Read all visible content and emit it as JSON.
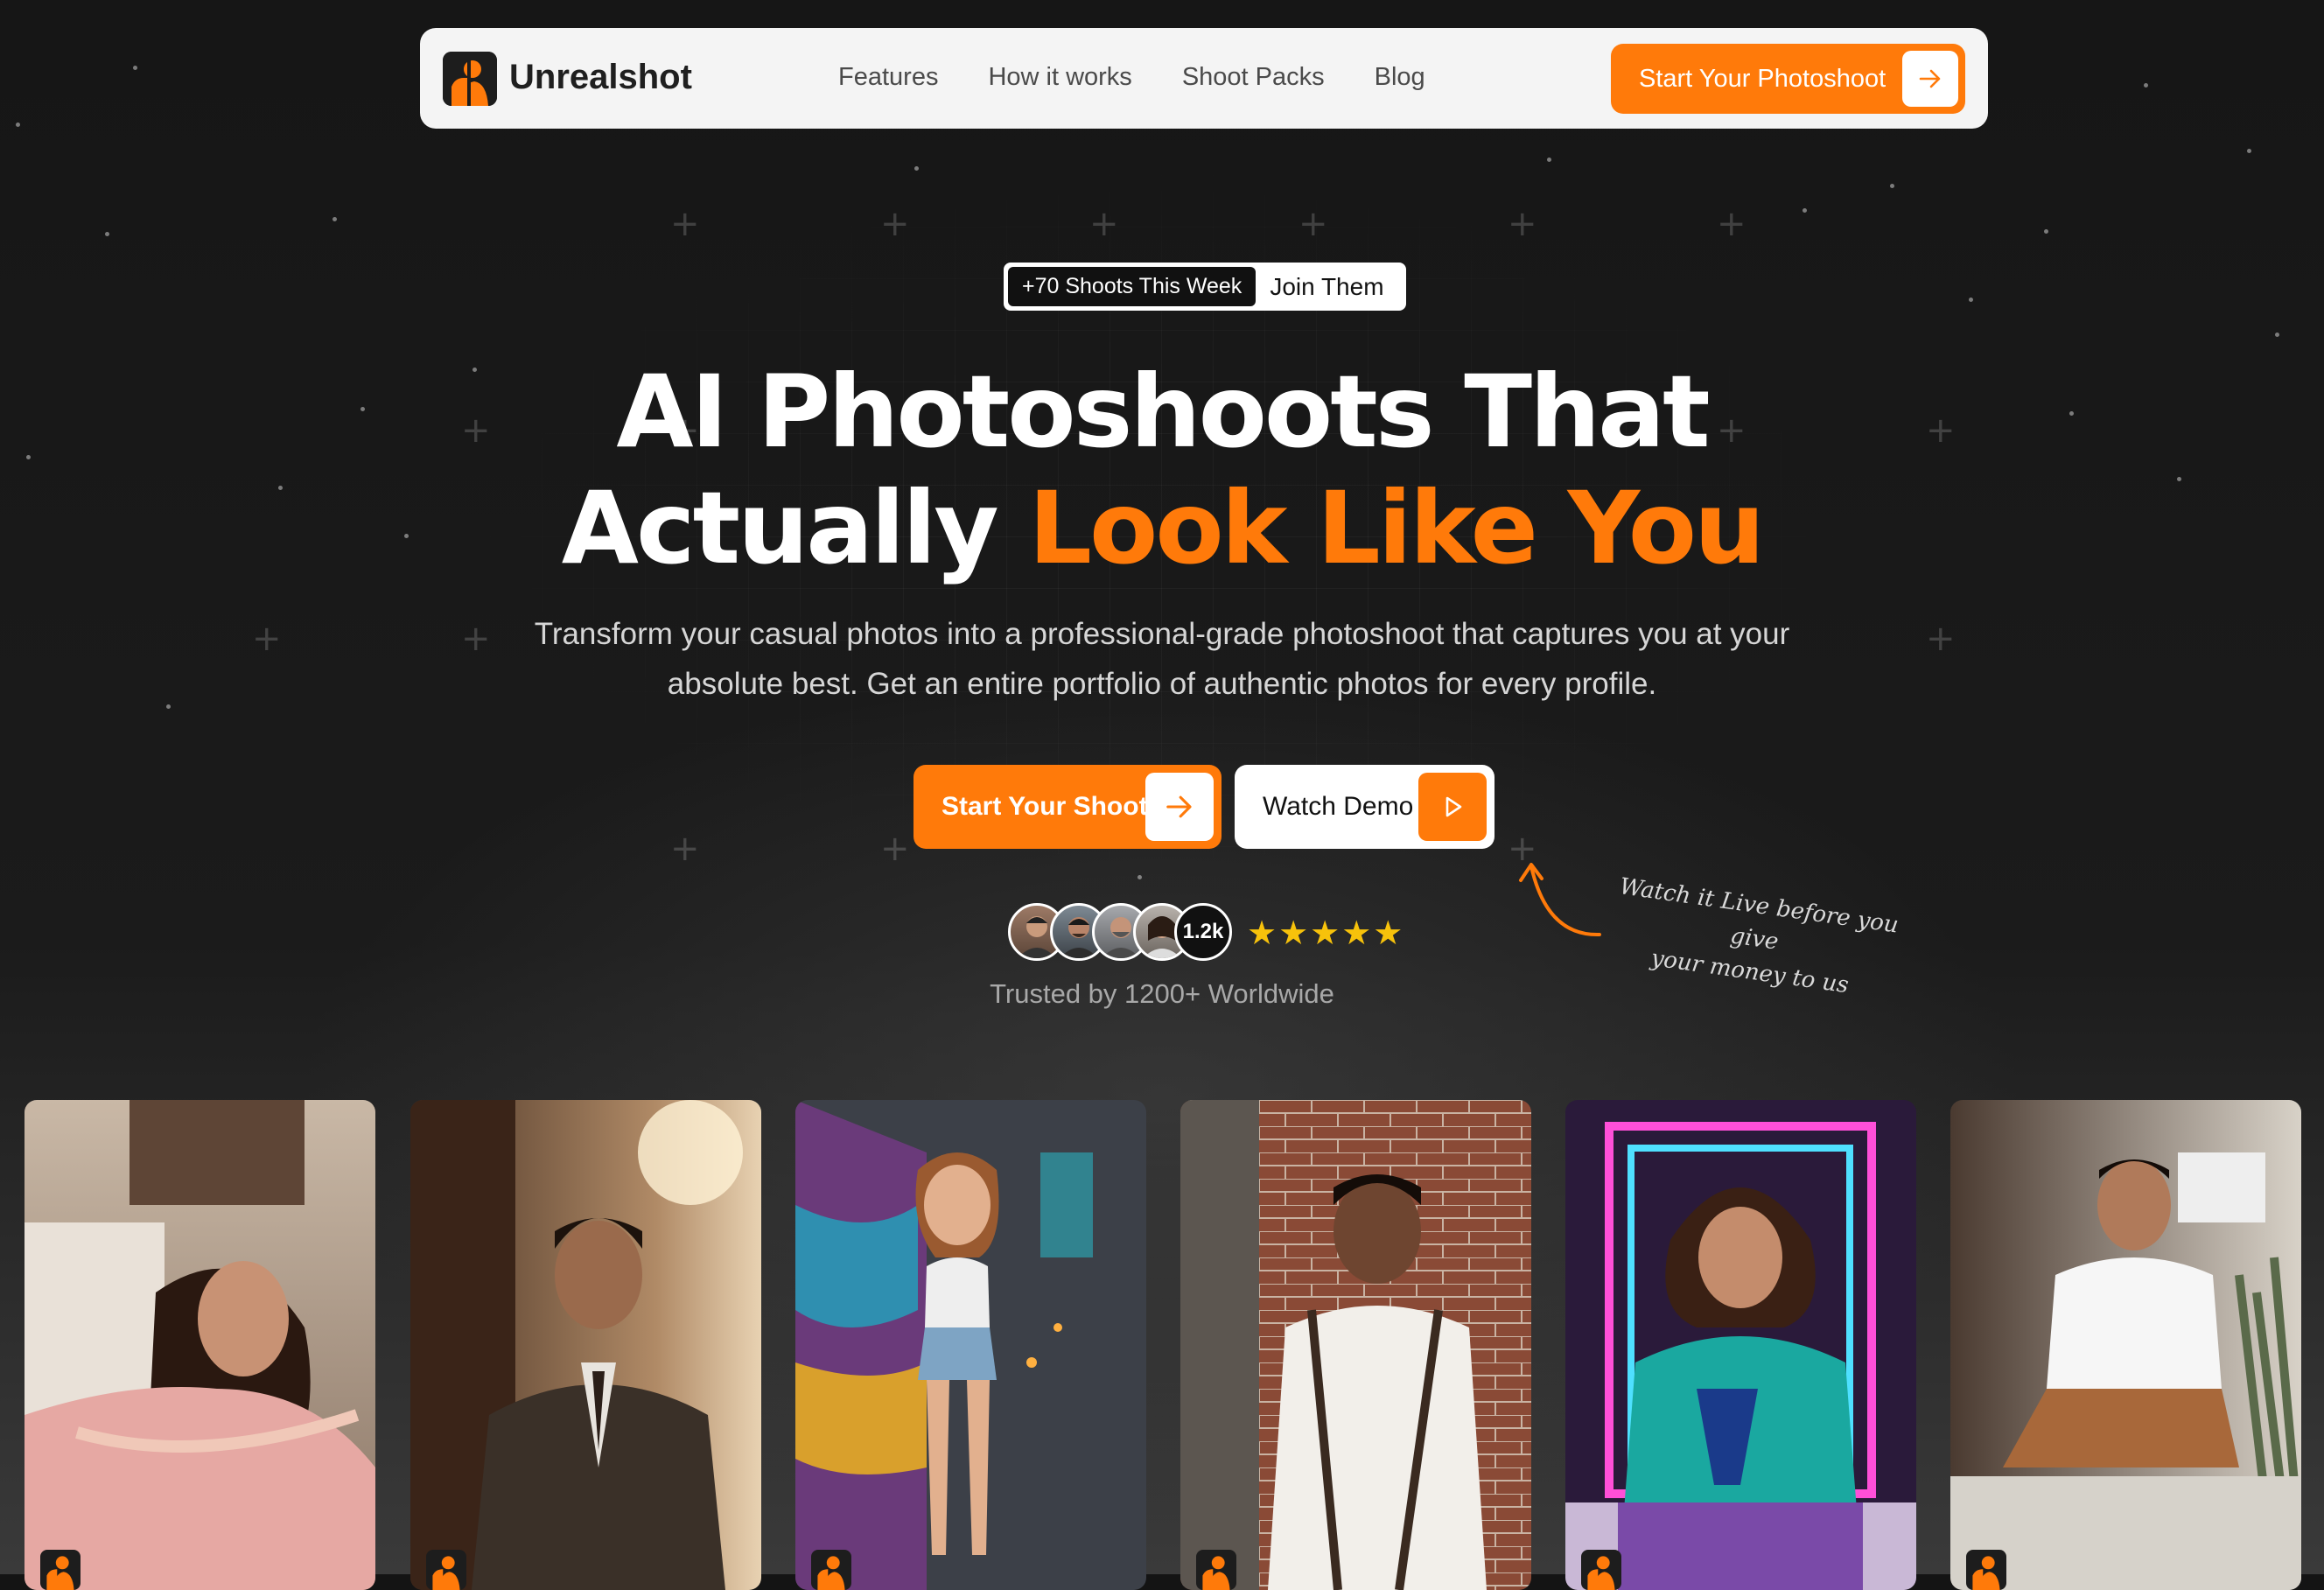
{
  "nav": {
    "brand": "Unrealshot",
    "links": [
      "Features",
      "How it works",
      "Shoot Packs",
      "Blog"
    ],
    "cta_label": "Start Your Photoshoot"
  },
  "badge": {
    "count_label": "+70 Shoots This Week",
    "join_label": "Join Them"
  },
  "hero": {
    "headline_line1": "AI Photoshoots That",
    "headline_line2_white": "Actually",
    "headline_line2_orange": "Look Like You",
    "subtitle_line1": "Transform your casual photos into a professional-grade photoshoot that captures you at your",
    "subtitle_line2": "absolute best. Get an entire portfolio of authentic photos for every profile."
  },
  "buttons": {
    "primary_label": "Start Your Shoot",
    "secondary_label": "Watch Demo"
  },
  "social_proof": {
    "avatar_count_label": "1.2k",
    "rating_stars": "★★★★★",
    "trusted_text": "Trusted by 1200+ Worldwide"
  },
  "handnote": {
    "line1": "Watch it Live before you give",
    "line2": "your money to us"
  },
  "gallery": {
    "cards": [
      {
        "icon": "woman-pink-saree-photo"
      },
      {
        "icon": "man-brown-suit-photo"
      },
      {
        "icon": "woman-graffiti-alley-photo"
      },
      {
        "icon": "man-brick-wall-photo"
      },
      {
        "icon": "woman-neon-retro-photo"
      },
      {
        "icon": "man-white-tee-photo"
      }
    ]
  },
  "colors": {
    "accent": "#ff7a0a",
    "background": "#141414",
    "nav_bg": "#f4f4f4",
    "star": "#f7c20b"
  }
}
